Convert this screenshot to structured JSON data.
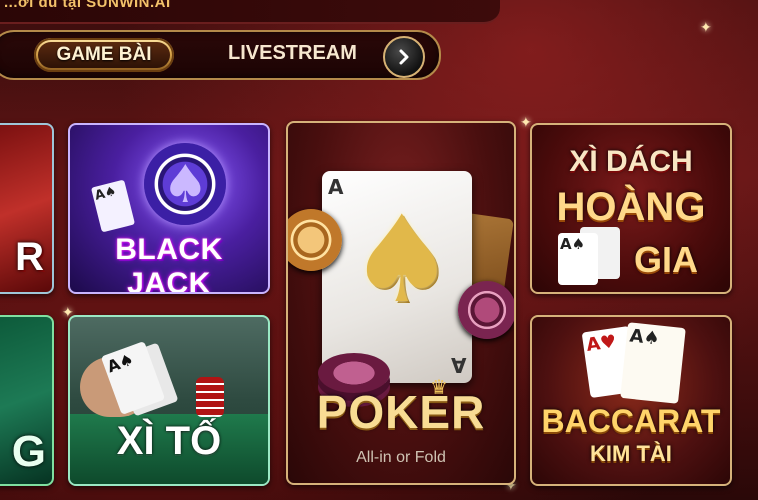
{
  "header": {
    "banner_text": "...ới đủ tại SUNWIN.AI"
  },
  "nav": {
    "tabs": [
      {
        "label": "GAME BÀI",
        "active": true
      },
      {
        "label": "LIVESTREAM",
        "active": false
      }
    ],
    "next_icon": "chevron-right-icon"
  },
  "games": {
    "partial_top": {
      "title_fragment": "R"
    },
    "partial_bottom": {
      "title_fragment": "G"
    },
    "blackjack": {
      "title": "BLACK JACK",
      "card_rank": "A"
    },
    "xito": {
      "title": "XÌ TỐ",
      "card_rank": "A"
    },
    "poker": {
      "title": "POKER",
      "subtitle": "All-in or Fold",
      "card_rank": "A"
    },
    "xidach": {
      "line1": "XÌ DÁCH",
      "line2": "HOÀNG",
      "line3": "GIA",
      "card_rank": "A"
    },
    "baccarat": {
      "line1": "BACCARAT",
      "line2": "KIM TÀI",
      "card1_rank": "A",
      "card2_rank": "A"
    }
  },
  "colors": {
    "accent_gold": "#d6b27a",
    "background": "#4a0f0f"
  }
}
